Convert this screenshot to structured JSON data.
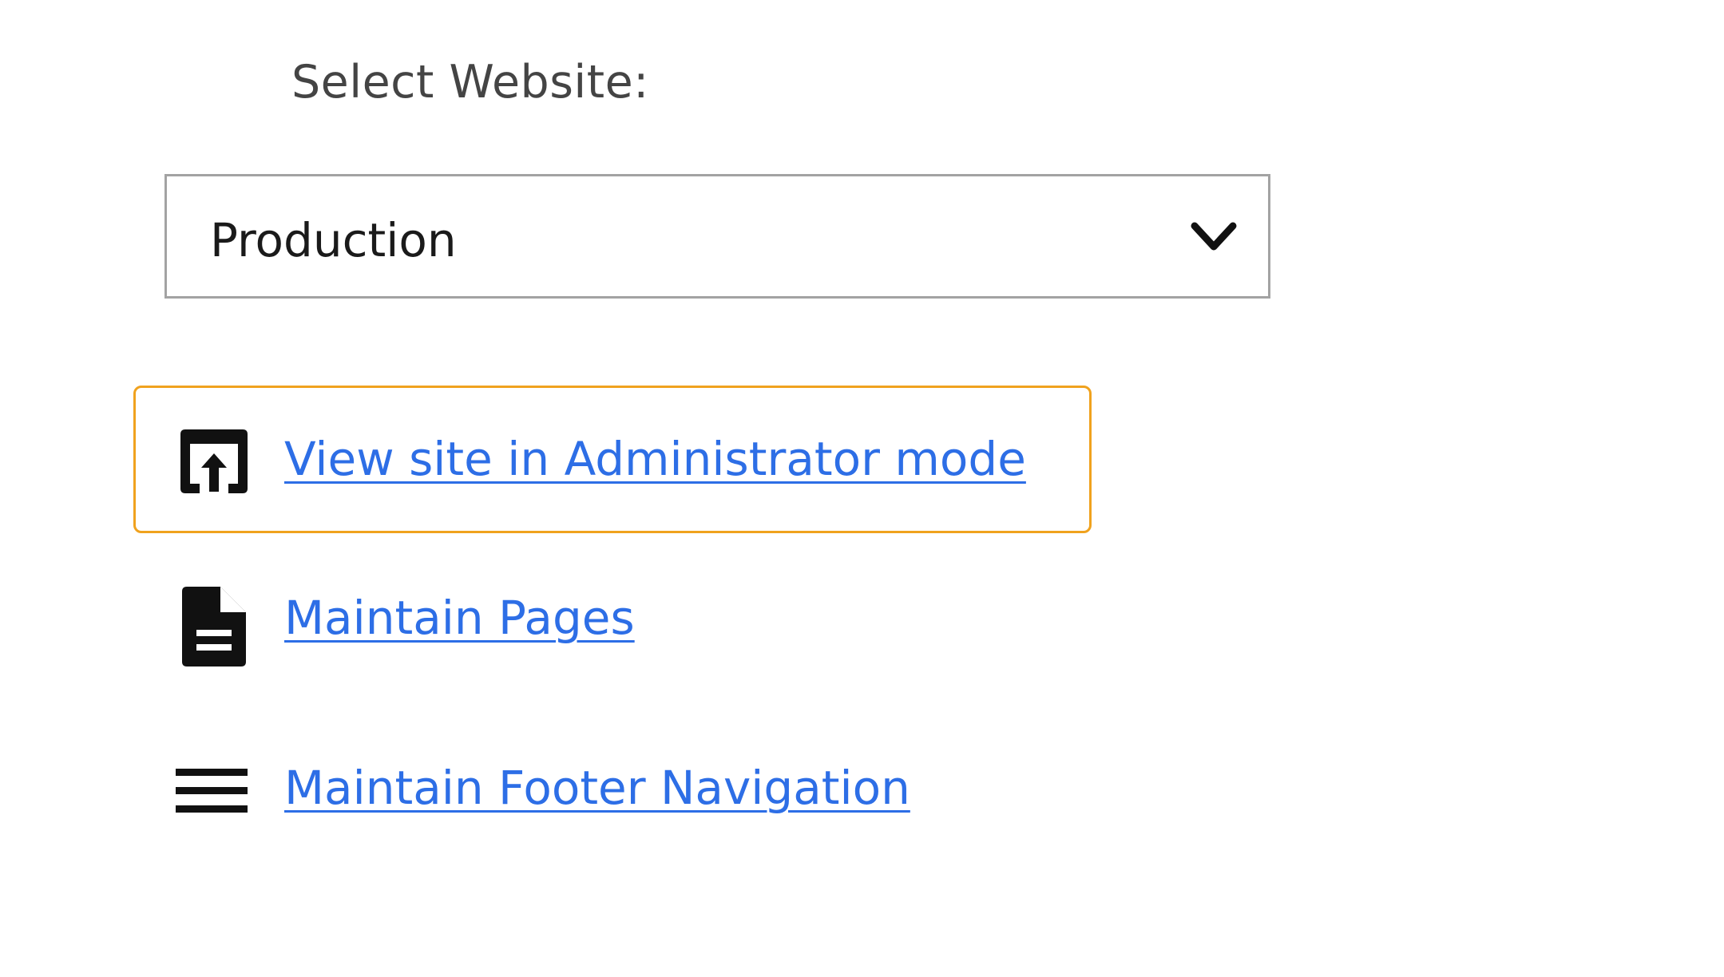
{
  "select_website": {
    "label": "Select Website:",
    "selected_value": "Production"
  },
  "links": [
    {
      "label": "View site in Administrator mode",
      "icon": "open-in-new-window-icon",
      "focused": true
    },
    {
      "label": "Maintain Pages",
      "icon": "document-icon",
      "focused": false
    },
    {
      "label": "Maintain Footer Navigation",
      "icon": "menu-lines-icon",
      "focused": false
    }
  ],
  "colors": {
    "link": "#2d6ee6",
    "focus_outline": "#f0a21e",
    "select_border": "#a3a3a3",
    "label_text": "#444444",
    "icon": "#111111"
  }
}
